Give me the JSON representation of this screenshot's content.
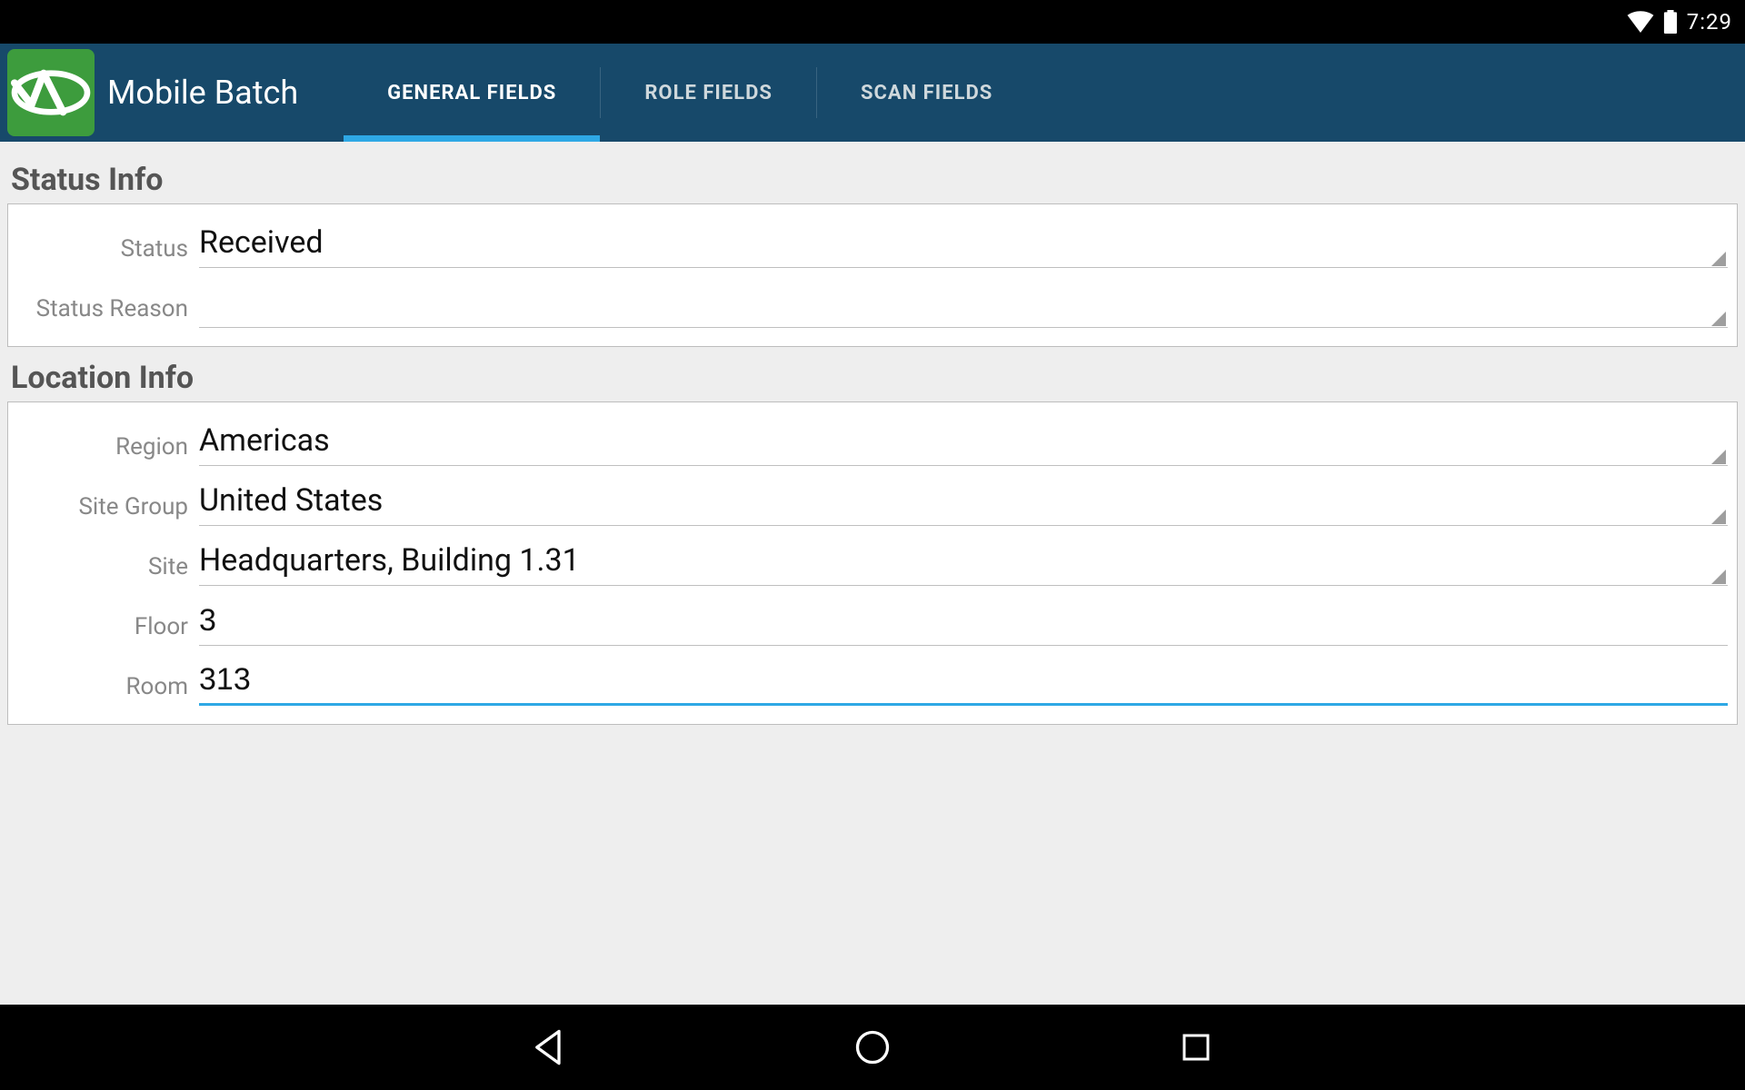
{
  "status_bar": {
    "time": "7:29"
  },
  "app": {
    "title": "Mobile Batch"
  },
  "tabs": [
    {
      "label": "GENERAL FIELDS",
      "active": true
    },
    {
      "label": "ROLE FIELDS",
      "active": false
    },
    {
      "label": "SCAN FIELDS",
      "active": false
    }
  ],
  "sections": {
    "status_info": {
      "title": "Status Info",
      "fields": {
        "status": {
          "label": "Status",
          "value": "Received",
          "type": "spinner"
        },
        "status_reason": {
          "label": "Status Reason",
          "value": "",
          "type": "spinner"
        }
      }
    },
    "location_info": {
      "title": "Location Info",
      "fields": {
        "region": {
          "label": "Region",
          "value": "Americas",
          "type": "spinner"
        },
        "site_group": {
          "label": "Site Group",
          "value": "United States",
          "type": "spinner"
        },
        "site": {
          "label": "Site",
          "value": "Headquarters, Building 1.31",
          "type": "spinner"
        },
        "floor": {
          "label": "Floor",
          "value": "3",
          "type": "text"
        },
        "room": {
          "label": "Room",
          "value": "313",
          "type": "text",
          "focused": true
        }
      }
    }
  }
}
